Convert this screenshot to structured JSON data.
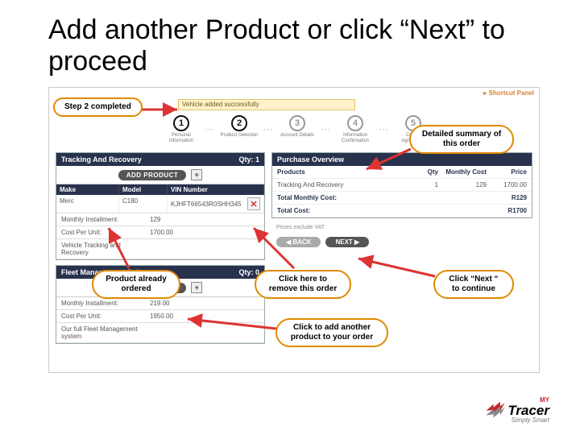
{
  "title": "Add another Product or click “Next” to proceed",
  "shortcut": "Shortcut Panel",
  "banner": "Vehicle added successfully",
  "steps": [
    {
      "n": "1",
      "label": "Personal Information",
      "done": true
    },
    {
      "n": "2",
      "label": "Product Selection",
      "done": true
    },
    {
      "n": "3",
      "label": "Account Details",
      "done": false
    },
    {
      "n": "4",
      "label": "Information Confirmation",
      "done": false
    },
    {
      "n": "5",
      "label": "Create Agreement",
      "done": false
    }
  ],
  "tracking": {
    "header": "Tracking And Recovery",
    "qty": "Qty: 1",
    "add": "ADD PRODUCT",
    "plus": "+",
    "cols": {
      "a": "Make",
      "b": "Model",
      "c": "VIN Number"
    },
    "row": {
      "a": "Merc",
      "b": "C180",
      "c": "KJHFT66543R0SHH345"
    },
    "kv": [
      {
        "k": "Monthly Installment:",
        "v": "129"
      },
      {
        "k": "Cost Per Unit:",
        "v": "1700.00"
      },
      {
        "k": "Vehicle Tracking and Recovery",
        "v": ""
      }
    ]
  },
  "fleet": {
    "header": "Fleet Management Only",
    "qty": "Qty: 0",
    "add": "ADD PRODUCT",
    "plus": "+",
    "kv": [
      {
        "k": "Monthly Installment:",
        "v": "219.00"
      },
      {
        "k": "Cost Per Unit:",
        "v": "1950.00"
      },
      {
        "k": "Our full Fleet Management system",
        "v": ""
      }
    ]
  },
  "purchase": {
    "header": "Purchase Overview",
    "cols": {
      "c1": "Products",
      "c2": "Qty",
      "c3": "Monthly Cost",
      "c4": "Price"
    },
    "rows": [
      {
        "c1": "Tracking And Recovery",
        "c2": "1",
        "c3": "129",
        "c4": "1700.00"
      }
    ],
    "totals": [
      {
        "label": "Total Monthly Cost:",
        "val": "R129"
      },
      {
        "label": "Total Cost:",
        "val": "R1700"
      }
    ],
    "vat": "Prices exclude VAT"
  },
  "nav": {
    "back": "BACK",
    "next": "NEXT"
  },
  "callouts": {
    "c1": "Step 2 completed",
    "c2": "Detailed summary of this order",
    "c3": "Product already ordered",
    "c4": "Click here to remove this order",
    "c5": "Click “Next “ to continue",
    "c6": "Click to add another product to your order"
  },
  "logo": {
    "my": "MY",
    "name": "Tracer",
    "tag": "Simply Smart"
  }
}
